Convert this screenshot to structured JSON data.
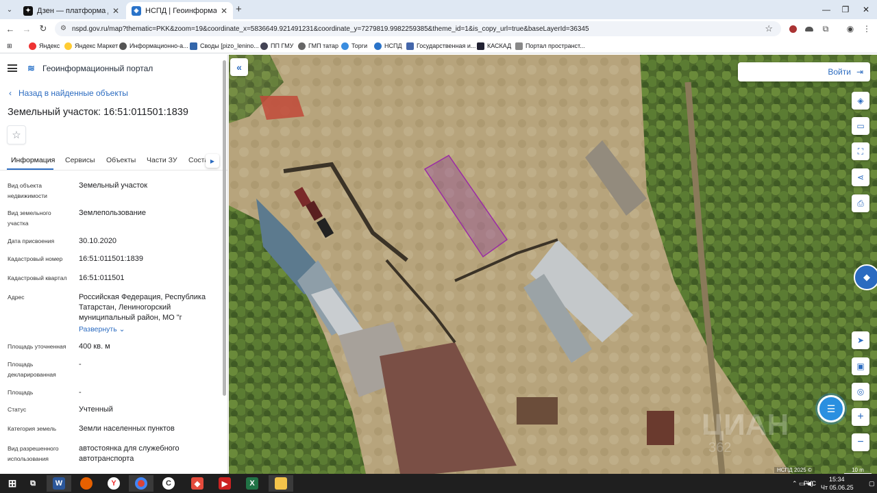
{
  "browser": {
    "tabs": [
      {
        "title": "Дзен — платформа для прос",
        "active": false
      },
      {
        "title": "НСПД | Геоинформационный",
        "active": true
      }
    ],
    "new_tab": "+",
    "url": "nspd.gov.ru/map?thematic=PKK&zoom=19&coordinate_x=5836649.921491231&coordinate_y=7279819.9982259385&theme_id=1&is_copy_url=true&baseLayerId=36345",
    "bookmarks": [
      "Яндекс",
      "Яндекс Маркет",
      "Информационно-а...",
      "Своды [pizo_lenino...",
      "ПП ГМУ",
      "ГМП татар",
      "Торги",
      "НСПД",
      "Государственная и...",
      "КАСКАД",
      "Портал пространст..."
    ]
  },
  "panel": {
    "portal_title": "Геоинформационный портал",
    "back_label": "Назад в найденные объекты",
    "object_title": "Земельный участок: 16:51:011501:1839",
    "tabs": [
      "Информация",
      "Сервисы",
      "Объекты",
      "Части ЗУ",
      "Соста"
    ],
    "fields": [
      {
        "label": "Вид объекта недвижимости",
        "value": "Земельный участок"
      },
      {
        "label": "Вид земельного участка",
        "value": "Землепользование"
      },
      {
        "label": "Дата присвоения",
        "value": "30.10.2020"
      },
      {
        "label": "Кадастровый номер",
        "value": "16:51:011501:1839"
      },
      {
        "label": "Кадастровый квартал",
        "value": "16:51:011501"
      },
      {
        "label": "Адрес",
        "value": "Российская Федерация, Республика Татарстан, Лениногорский муниципальный район, МО \"г"
      },
      {
        "label": "Площадь уточненная",
        "value": "400 кв. м"
      },
      {
        "label": "Площадь декларированная",
        "value": "-"
      },
      {
        "label": "Площадь",
        "value": "-"
      },
      {
        "label": "Статус",
        "value": "Учтенный"
      },
      {
        "label": "Категория земель",
        "value": "Земли населенных пунктов"
      },
      {
        "label": "Вид разрешенного использования",
        "value": "автостоянка для служебного автотранспорта"
      }
    ],
    "expand_label": "Развернуть"
  },
  "map": {
    "login_label": "Войти",
    "attribution": "НСПД 2025 ©",
    "scale_label": "10 m",
    "watermark": "ЦИАН",
    "watermark_sub": "362",
    "parcel_color": "#9b2aa6"
  },
  "taskbar": {
    "lang": "РУС",
    "time": "15:34",
    "date": "Чт 05.06.25"
  }
}
